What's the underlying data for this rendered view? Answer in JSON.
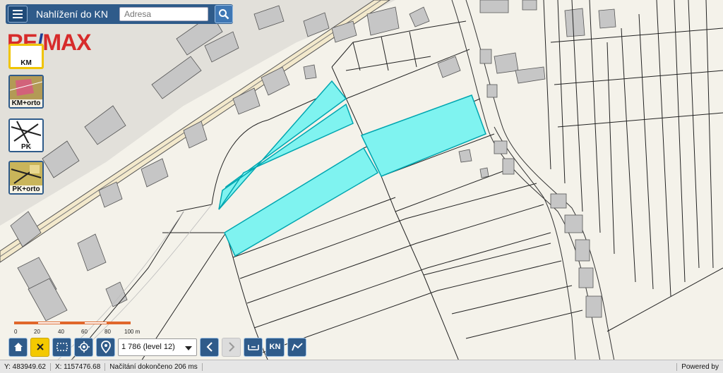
{
  "header": {
    "title": "Nahlížení do KN",
    "search_placeholder": "Adresa"
  },
  "logo": {
    "part1": "RE",
    "slash": "/",
    "part2": "MAX"
  },
  "layers": [
    {
      "label": "KM",
      "active": true
    },
    {
      "label": "KM+orto",
      "active": false
    },
    {
      "label": "PK",
      "active": false
    },
    {
      "label": "PK+orto",
      "active": false
    }
  ],
  "scale_bar": {
    "labels": [
      "0",
      "20",
      "40",
      "60",
      "80",
      "100 m"
    ],
    "colors": [
      "#e0672b",
      "#ffffff",
      "#e0672b",
      "#ffffff",
      "#e0672b"
    ]
  },
  "toolbar": {
    "scale_value": "1 786 (level 12)",
    "km_button_label": "KN",
    "icons": [
      "home-icon",
      "close-icon",
      "select-area-icon",
      "locate-icon",
      "map-pin-icon",
      "back-icon",
      "forward-icon",
      "measure-icon",
      "kn-icon",
      "draw-icon"
    ]
  },
  "status": {
    "y_coord": "Y: 483949.62",
    "x_coord": "X: 1157476.68",
    "load_message": "Načítání dokončeno 206 ms",
    "powered_by": "Powered by"
  },
  "colors": {
    "highlight": "#7ff3f0",
    "highlight_stroke": "#00b7c0",
    "map_background": "#f4f2ea",
    "road": "#f3e9cc",
    "building": "#c9c9c9",
    "accent_blue": "#2f5b8a"
  }
}
